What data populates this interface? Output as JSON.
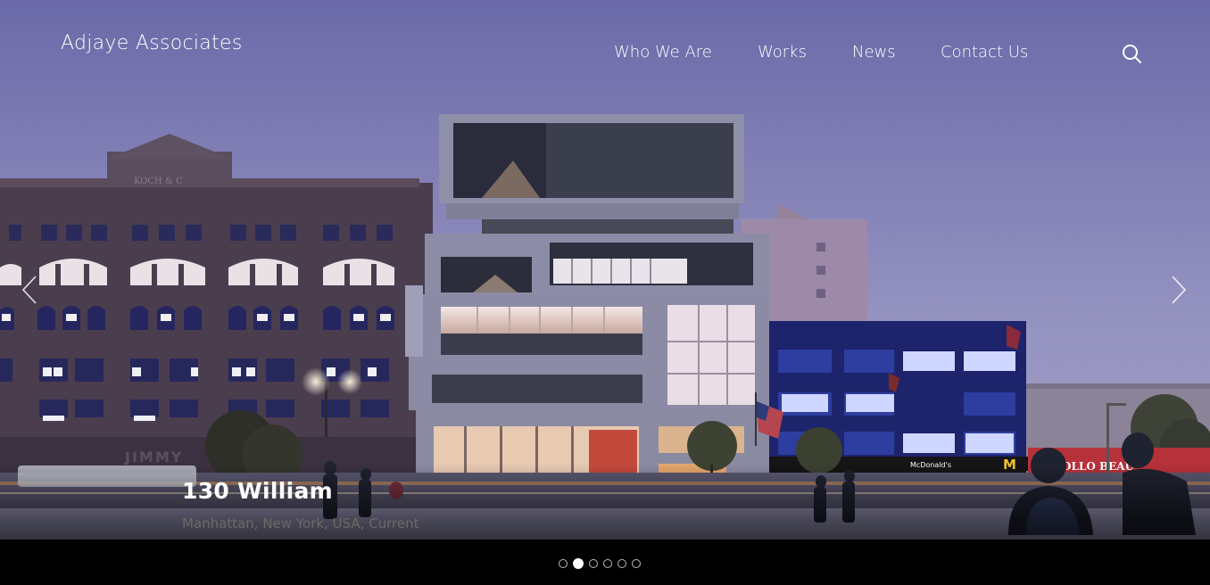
{
  "site": {
    "logo_text": "Adjaye Associates"
  },
  "nav": {
    "items": [
      {
        "label": "Who We Are"
      },
      {
        "label": "Works"
      },
      {
        "label": "News"
      },
      {
        "label": "Contact Us"
      }
    ],
    "search_icon": "search-icon"
  },
  "slide": {
    "title": "130 William",
    "subtitle": "Manhattan, New York, USA, Current",
    "storefront_sign": "JIMMY",
    "building_sign": "KOCH & C",
    "mcdonalds_sign": "McDonald's",
    "apollo_sign": "OLLO BEAU"
  },
  "carousel": {
    "prev_icon": "chevron-left-icon",
    "next_icon": "chevron-right-icon",
    "slide_count": 6,
    "active_index": 1
  },
  "colors": {
    "sky_top": "#6d6cab",
    "sky_bottom": "#a7a4c6",
    "footer_bar": "#000000",
    "text": "#ffffff"
  }
}
